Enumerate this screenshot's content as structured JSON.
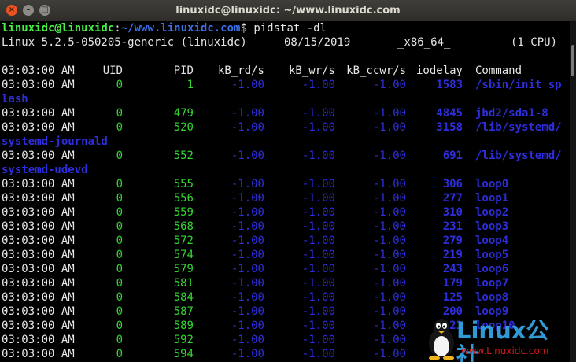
{
  "window": {
    "title": "linuxidc@linuxidc: ~/www.linuxidc.com",
    "controls": [
      "×",
      "–",
      "□"
    ]
  },
  "prompt": {
    "user_host": "linuxidc@linuxidc",
    "sep": ":",
    "path": "~/www.linuxidc.com",
    "symbol": "$",
    "command": " pidstat -dl"
  },
  "sysinfo": {
    "kernel": "Linux 5.2.5-050205-generic (linuxidc)",
    "date": "08/15/2019",
    "arch": "_x86_64_",
    "cpus": "(1 CPU)"
  },
  "header": {
    "time": "03:03:00 AM",
    "uid": "UID",
    "pid": "PID",
    "rd": "kB_rd/s",
    "wr": "kB_wr/s",
    "ccwr": "kB_ccwr/s",
    "iodelay": "iodelay",
    "command": "Command"
  },
  "rows": [
    {
      "time": "03:03:00 AM",
      "uid": "0",
      "pid": "1",
      "rd": "-1.00",
      "wr": "-1.00",
      "ccwr": "-1.00",
      "iodelay": "1583",
      "cmd": "/sbin/init sp",
      "cont": "lash"
    },
    {
      "time": "03:03:00 AM",
      "uid": "0",
      "pid": "479",
      "rd": "-1.00",
      "wr": "-1.00",
      "ccwr": "-1.00",
      "iodelay": "4845",
      "cmd": "jbd2/sda1-8"
    },
    {
      "time": "03:03:00 AM",
      "uid": "0",
      "pid": "520",
      "rd": "-1.00",
      "wr": "-1.00",
      "ccwr": "-1.00",
      "iodelay": "3158",
      "cmd": "/lib/systemd/",
      "cont": "systemd-journald"
    },
    {
      "time": "03:03:00 AM",
      "uid": "0",
      "pid": "552",
      "rd": "-1.00",
      "wr": "-1.00",
      "ccwr": "-1.00",
      "iodelay": "691",
      "cmd": "/lib/systemd/",
      "cont": "systemd-udevd"
    },
    {
      "time": "03:03:00 AM",
      "uid": "0",
      "pid": "555",
      "rd": "-1.00",
      "wr": "-1.00",
      "ccwr": "-1.00",
      "iodelay": "306",
      "cmd": "loop0"
    },
    {
      "time": "03:03:00 AM",
      "uid": "0",
      "pid": "556",
      "rd": "-1.00",
      "wr": "-1.00",
      "ccwr": "-1.00",
      "iodelay": "277",
      "cmd": "loop1"
    },
    {
      "time": "03:03:00 AM",
      "uid": "0",
      "pid": "559",
      "rd": "-1.00",
      "wr": "-1.00",
      "ccwr": "-1.00",
      "iodelay": "310",
      "cmd": "loop2"
    },
    {
      "time": "03:03:00 AM",
      "uid": "0",
      "pid": "568",
      "rd": "-1.00",
      "wr": "-1.00",
      "ccwr": "-1.00",
      "iodelay": "231",
      "cmd": "loop3"
    },
    {
      "time": "03:03:00 AM",
      "uid": "0",
      "pid": "572",
      "rd": "-1.00",
      "wr": "-1.00",
      "ccwr": "-1.00",
      "iodelay": "279",
      "cmd": "loop4"
    },
    {
      "time": "03:03:00 AM",
      "uid": "0",
      "pid": "574",
      "rd": "-1.00",
      "wr": "-1.00",
      "ccwr": "-1.00",
      "iodelay": "219",
      "cmd": "loop5"
    },
    {
      "time": "03:03:00 AM",
      "uid": "0",
      "pid": "579",
      "rd": "-1.00",
      "wr": "-1.00",
      "ccwr": "-1.00",
      "iodelay": "243",
      "cmd": "loop6"
    },
    {
      "time": "03:03:00 AM",
      "uid": "0",
      "pid": "581",
      "rd": "-1.00",
      "wr": "-1.00",
      "ccwr": "-1.00",
      "iodelay": "179",
      "cmd": "loop7"
    },
    {
      "time": "03:03:00 AM",
      "uid": "0",
      "pid": "584",
      "rd": "-1.00",
      "wr": "-1.00",
      "ccwr": "-1.00",
      "iodelay": "125",
      "cmd": "loop8"
    },
    {
      "time": "03:03:00 AM",
      "uid": "0",
      "pid": "587",
      "rd": "-1.00",
      "wr": "-1.00",
      "ccwr": "-1.00",
      "iodelay": "200",
      "cmd": "loop9"
    },
    {
      "time": "03:03:00 AM",
      "uid": "0",
      "pid": "589",
      "rd": "-1.00",
      "wr": "-1.00",
      "ccwr": "-1.00",
      "iodelay": "121",
      "cmd": "loop10"
    },
    {
      "time": "03:03:00 AM",
      "uid": "0",
      "pid": "592",
      "rd": "-1.00",
      "wr": "-1.00",
      "ccwr": "-1.00",
      "iodelay": "",
      "cmd": ""
    },
    {
      "time": "03:03:00 AM",
      "uid": "0",
      "pid": "594",
      "rd": "-1.00",
      "wr": "-1.00",
      "ccwr": "-1.00",
      "iodelay": "",
      "cmd": ""
    }
  ],
  "watermark": {
    "brand": "Linux公社",
    "url": "www.Linuxidc.com"
  },
  "colors": {
    "terminal_bg": "#000000",
    "green": "#33d633",
    "blue": "#2e2edc",
    "accent": "#e95420"
  }
}
